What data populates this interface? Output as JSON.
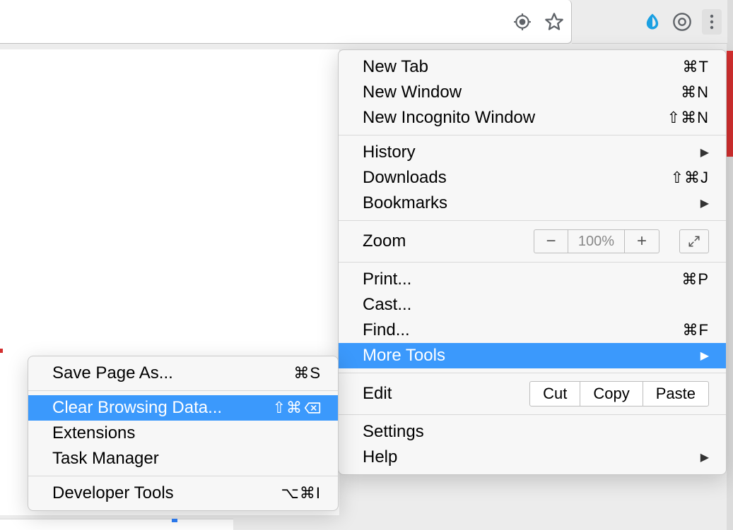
{
  "toolbar": {
    "target_icon": "target-icon",
    "star_icon": "star-icon",
    "ext_icon": "s-extension-icon",
    "pw_icon": "password-manager-icon",
    "menu_icon": "kebab-menu-icon"
  },
  "main_menu": {
    "new_tab": {
      "label": "New Tab",
      "shortcut": "⌘T"
    },
    "new_window": {
      "label": "New Window",
      "shortcut": "⌘N"
    },
    "new_incognito": {
      "label": "New Incognito Window",
      "shortcut": "⇧⌘N"
    },
    "history": {
      "label": "History"
    },
    "downloads": {
      "label": "Downloads",
      "shortcut": "⇧⌘J"
    },
    "bookmarks": {
      "label": "Bookmarks"
    },
    "zoom": {
      "label": "Zoom",
      "value": "100%"
    },
    "print": {
      "label": "Print...",
      "shortcut": "⌘P"
    },
    "cast": {
      "label": "Cast..."
    },
    "find": {
      "label": "Find...",
      "shortcut": "⌘F"
    },
    "more_tools": {
      "label": "More Tools"
    },
    "edit": {
      "label": "Edit",
      "cut": "Cut",
      "copy": "Copy",
      "paste": "Paste"
    },
    "settings": {
      "label": "Settings"
    },
    "help": {
      "label": "Help"
    }
  },
  "sub_menu": {
    "save_page": {
      "label": "Save Page As...",
      "shortcut": "⌘S"
    },
    "clear_data": {
      "label": "Clear Browsing Data...",
      "shortcut_prefix": "⇧⌘"
    },
    "extensions": {
      "label": "Extensions"
    },
    "task_mgr": {
      "label": "Task Manager"
    },
    "dev_tools": {
      "label": "Developer Tools",
      "shortcut": "⌥⌘I"
    }
  }
}
